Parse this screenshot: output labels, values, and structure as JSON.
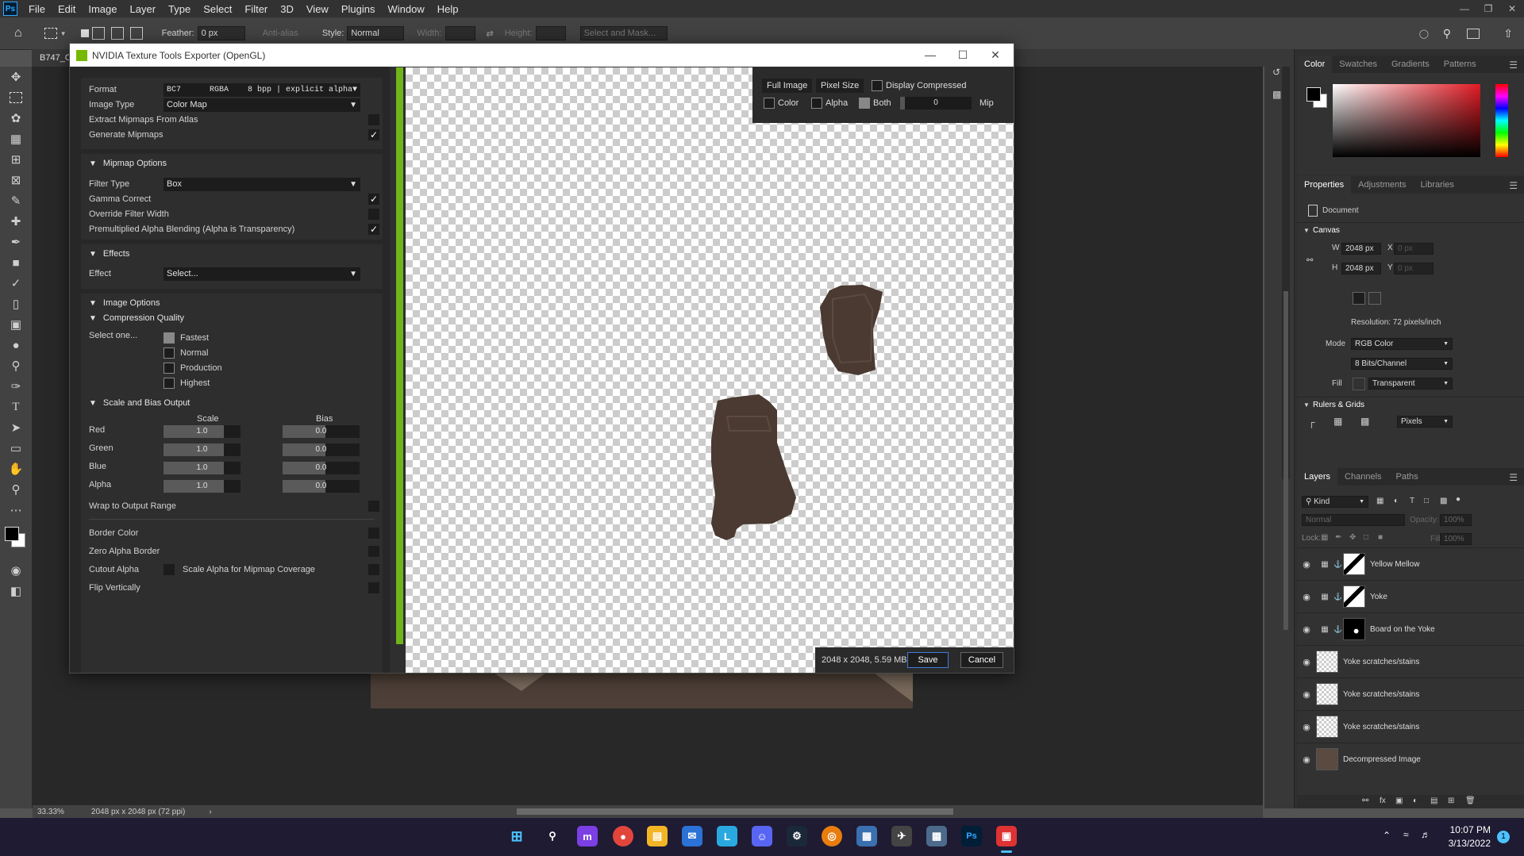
{
  "app": {
    "logo": "Ps",
    "menu": [
      "File",
      "Edit",
      "Image",
      "Layer",
      "Type",
      "Select",
      "Filter",
      "3D",
      "View",
      "Plugins",
      "Window",
      "Help"
    ]
  },
  "options_bar": {
    "feather_label": "Feather:",
    "feather_value": "0 px",
    "anti_alias": "Anti-alias",
    "style_label": "Style:",
    "style_value": "Normal",
    "width_label": "Width:",
    "height_label": "Height:",
    "select_mask": "Select and Mask..."
  },
  "document_tab": {
    "label": "B747_C"
  },
  "status_bar": {
    "zoom": "33.33%",
    "doc_info": "2048 px x 2048 px (72 ppi)"
  },
  "dialog": {
    "title": "NVIDIA Texture Tools Exporter (OpenGL)",
    "format_label": "Format",
    "format_value": "BC7      RGBA    8 bpp | explicit alpha",
    "image_type_label": "Image Type",
    "image_type_value": "Color Map",
    "extract_mipmaps": "Extract Mipmaps From Atlas",
    "generate_mipmaps": "Generate Mipmaps",
    "mipmap_options": "Mipmap Options",
    "filter_type_label": "Filter Type",
    "filter_type_value": "Box",
    "gamma_correct": "Gamma Correct",
    "override_filter_width": "Override Filter Width",
    "premultiplied": "Premultiplied Alpha Blending (Alpha is Transparency)",
    "effects": "Effects",
    "effect_label": "Effect",
    "effect_value": "Select...",
    "image_options": "Image Options",
    "compression_quality": "Compression Quality",
    "select_one": "Select one...",
    "quality_options": [
      "Fastest",
      "Normal",
      "Production",
      "Highest"
    ],
    "scale_bias": "Scale and Bias Output",
    "scale_header": "Scale",
    "bias_header": "Bias",
    "channels": [
      {
        "name": "Red",
        "scale": "1.0",
        "bias": "0.0"
      },
      {
        "name": "Green",
        "scale": "1.0",
        "bias": "0.0"
      },
      {
        "name": "Blue",
        "scale": "1.0",
        "bias": "0.0"
      },
      {
        "name": "Alpha",
        "scale": "1.0",
        "bias": "0.0"
      }
    ],
    "wrap_output": "Wrap to Output Range",
    "border_color": "Border Color",
    "zero_alpha_border": "Zero Alpha Border",
    "cutout_alpha": "Cutout Alpha",
    "scale_alpha_mip": "Scale Alpha for Mipmap Coverage",
    "flip_vertically": "Flip Vertically",
    "preview": {
      "full_image": "Full Image",
      "pixel_size": "Pixel Size",
      "display_compressed": "Display Compressed",
      "color": "Color",
      "alpha": "Alpha",
      "both": "Both",
      "mip_value": "0",
      "mip_label": "Mip"
    },
    "size_info": "2048 x 2048, 5.59 MB",
    "save": "Save",
    "cancel": "Cancel"
  },
  "color_panel": {
    "tabs": [
      "Color",
      "Swatches",
      "Gradients",
      "Patterns"
    ]
  },
  "properties_panel": {
    "tabs": [
      "Properties",
      "Adjustments",
      "Libraries"
    ],
    "document": "Document",
    "canvas": "Canvas",
    "w_label": "W",
    "w_value": "2048 px",
    "h_label": "H",
    "h_value": "2048 px",
    "x_label": "X",
    "y_label": "Y",
    "x_ph": "0 px",
    "y_ph": "0 px",
    "resolution": "Resolution: 72 pixels/inch",
    "mode_label": "Mode",
    "mode_value": "RGB Color",
    "bits_value": "8 Bits/Channel",
    "fill_label": "Fill",
    "fill_value": "Transparent",
    "rulers_grids": "Rulers & Grids",
    "units_value": "Pixels"
  },
  "layers_panel": {
    "tabs": [
      "Layers",
      "Channels",
      "Paths"
    ],
    "kind": "Kind",
    "blend": "Normal",
    "opacity_label": "Opacity:",
    "opacity_value": "100%",
    "lock_label": "Lock:",
    "fill_label": "Fill:",
    "fill_value": "100%",
    "layers": [
      {
        "name": "Yellow Mellow",
        "thumb": "mask"
      },
      {
        "name": "Yoke",
        "thumb": "mask"
      },
      {
        "name": "Board on the Yoke",
        "thumb": "dark"
      },
      {
        "name": "Yoke scratches/stains",
        "thumb": "checker"
      },
      {
        "name": "Yoke scratches/stains",
        "thumb": "checker"
      },
      {
        "name": "Yoke scratches/stains",
        "thumb": "checker"
      },
      {
        "name": "Decompressed Image",
        "thumb": "photo"
      }
    ]
  },
  "taskbar": {
    "time": "10:07 PM",
    "date": "3/13/2022",
    "notif": "1"
  },
  "colors": {
    "accent_green": "#6fb41a",
    "ps_blue": "#31a8ff",
    "texture_brown": "#4a3a32"
  }
}
